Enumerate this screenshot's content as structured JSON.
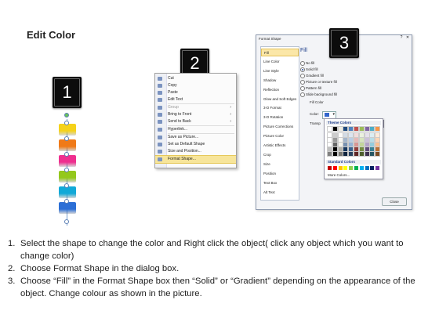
{
  "heading": "Edit Color",
  "badges": [
    "1",
    "2",
    "3"
  ],
  "shape_colors": [
    "#f5d21a",
    "#f07a18",
    "#ef2f8f",
    "#94c81c",
    "#12a9d8",
    "#2c6fd6"
  ],
  "context_menu": {
    "items": [
      {
        "label": "Cut",
        "submenu": false
      },
      {
        "label": "Copy",
        "submenu": false
      },
      {
        "label": "Paste",
        "submenu": false
      },
      {
        "label": "Edit Text",
        "submenu": false
      },
      {
        "label": "Group",
        "submenu": true,
        "disabled": true
      },
      {
        "label": "Bring to Front",
        "submenu": true
      },
      {
        "label": "Send to Back",
        "submenu": true
      },
      {
        "label": "Hyperlink...",
        "submenu": false
      },
      {
        "label": "Save as Picture...",
        "submenu": false
      },
      {
        "label": "Set as Default Shape",
        "submenu": false
      },
      {
        "label": "Size and Position...",
        "submenu": false
      },
      {
        "label": "Format Shape...",
        "submenu": false,
        "highlighted": true
      }
    ],
    "submenu_arrow": "›"
  },
  "format_dialog": {
    "title": "Format Shape",
    "controls": {
      "help": "?",
      "close": "✕"
    },
    "nav": [
      "Fill",
      "Line Color",
      "Line Style",
      "Shadow",
      "Reflection",
      "Glow and Soft Edges",
      "3-D Format",
      "3-D Rotation",
      "Picture Corrections",
      "Picture Color",
      "Artistic Effects",
      "Crop",
      "Size",
      "Position",
      "Text Box",
      "Alt Text"
    ],
    "section_title": "Fill",
    "options": [
      "No fill",
      "Solid fill",
      "Gradient fill",
      "Picture or texture fill",
      "Pattern fill",
      "Slide background fill"
    ],
    "selected_option": 1,
    "fill_color_label": "Fill Color",
    "color_label": "Color:",
    "transparency_label": "Transp",
    "close_button": "Close",
    "palette": {
      "theme_title": "Theme Colors",
      "standard_title": "Standard Colors",
      "more_colors": "More Colors...",
      "theme_base": [
        "#ffffff",
        "#000000",
        "#eeece1",
        "#1f497d",
        "#4f81bd",
        "#c0504d",
        "#9bbb59",
        "#8064a2",
        "#4bacc6",
        "#f79646"
      ],
      "standard": [
        "#c00000",
        "#ff0000",
        "#ffc000",
        "#ffff00",
        "#92d050",
        "#00b050",
        "#00b0f0",
        "#0070c0",
        "#002060",
        "#7030a0"
      ]
    }
  },
  "instructions": [
    {
      "num": "1.",
      "text": "Select the shape to change the color and Right click the object( click any object which you want to change color)"
    },
    {
      "num": "2.",
      "text": "Choose Format Shape in the dialog box."
    },
    {
      "num": "3.",
      "text": "Choose “Fill” in the Format Shape box then “Solid” or “Gradient” depending on the appearance of the object. Change colour as shown in the picture."
    }
  ]
}
